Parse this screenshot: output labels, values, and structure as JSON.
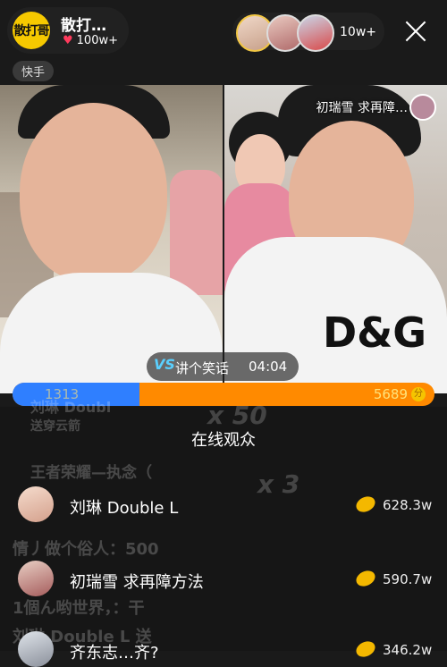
{
  "host": {
    "name": "散打…",
    "likes": "100w+",
    "logo_text": "散打哥",
    "platform": "快手"
  },
  "viewers": {
    "count": "10w+"
  },
  "pk": {
    "opponent_name": "初瑞雪 求再障…",
    "topic": "讲个笑话",
    "timer": "04:04",
    "vs_label": "VS",
    "left_score": "1313",
    "right_score": "5689",
    "left_share": 0.3,
    "coin_glyph": "分"
  },
  "background_chat": {
    "line1_user": "刘琳 Doubl",
    "line1_gift": "送穿云箭",
    "line1_mult": "x 50",
    "line2_user": "王者荣耀—执念（",
    "line2_mult": "x 3",
    "line3": "情丿做个俗人：500",
    "line4": "1個ん哟世界，：干",
    "line5": "刘琳 Double L 送"
  },
  "sheet": {
    "title": "在线观众",
    "rows": [
      {
        "name": "刘琳 Double L",
        "value": "628.3w"
      },
      {
        "name": "初瑞雪 求再障方法",
        "value": "590.7w"
      },
      {
        "name": "齐东志…齐?",
        "value": "346.2w"
      }
    ]
  },
  "colors": {
    "accent_orange": "#ff8a00",
    "accent_blue": "#2f7fff",
    "gold": "#f4b800"
  }
}
